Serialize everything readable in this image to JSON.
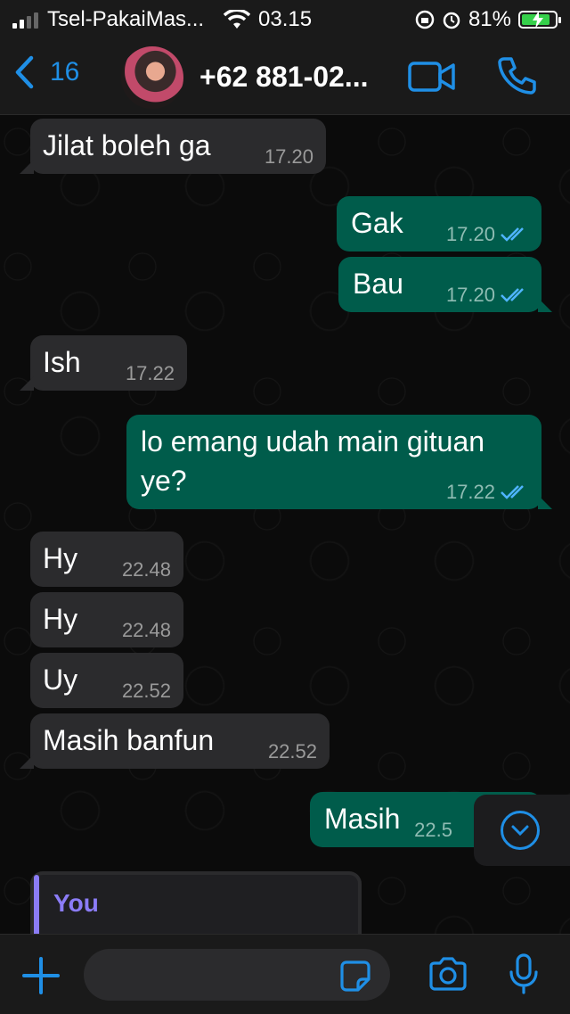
{
  "status_bar": {
    "carrier": "Tsel-PakaiMas...",
    "time": "03.15",
    "battery": "81%"
  },
  "header": {
    "back_count": "16",
    "contact_name": "+62 881-02..."
  },
  "messages": [
    {
      "dir": "in",
      "text": "Jilat boleh ga",
      "time": "17.20"
    },
    {
      "dir": "out",
      "text": "Gak",
      "time": "17.20",
      "read": true
    },
    {
      "dir": "out",
      "text": "Bau",
      "time": "17.20",
      "read": true
    },
    {
      "dir": "in",
      "text": "Ish",
      "time": "17.22"
    },
    {
      "dir": "out",
      "text": "lo emang udah main gituan ye?",
      "time": "17.22",
      "read": true
    },
    {
      "dir": "in",
      "text": "Hy",
      "time": "22.48"
    },
    {
      "dir": "in",
      "text": "Hy",
      "time": "22.48"
    },
    {
      "dir": "in",
      "text": "Uy",
      "time": "22.52"
    },
    {
      "dir": "in",
      "text": "Masih banfun",
      "time": "22.52"
    },
    {
      "dir": "out",
      "text": "Masih",
      "time": "22.5"
    }
  ],
  "reply_preview": {
    "sender": "You"
  },
  "colors": {
    "accent": "#1f8fe6",
    "outgoing": "#005c4b",
    "incoming": "#2b2b2d",
    "reply_name": "#8b7cf7"
  }
}
